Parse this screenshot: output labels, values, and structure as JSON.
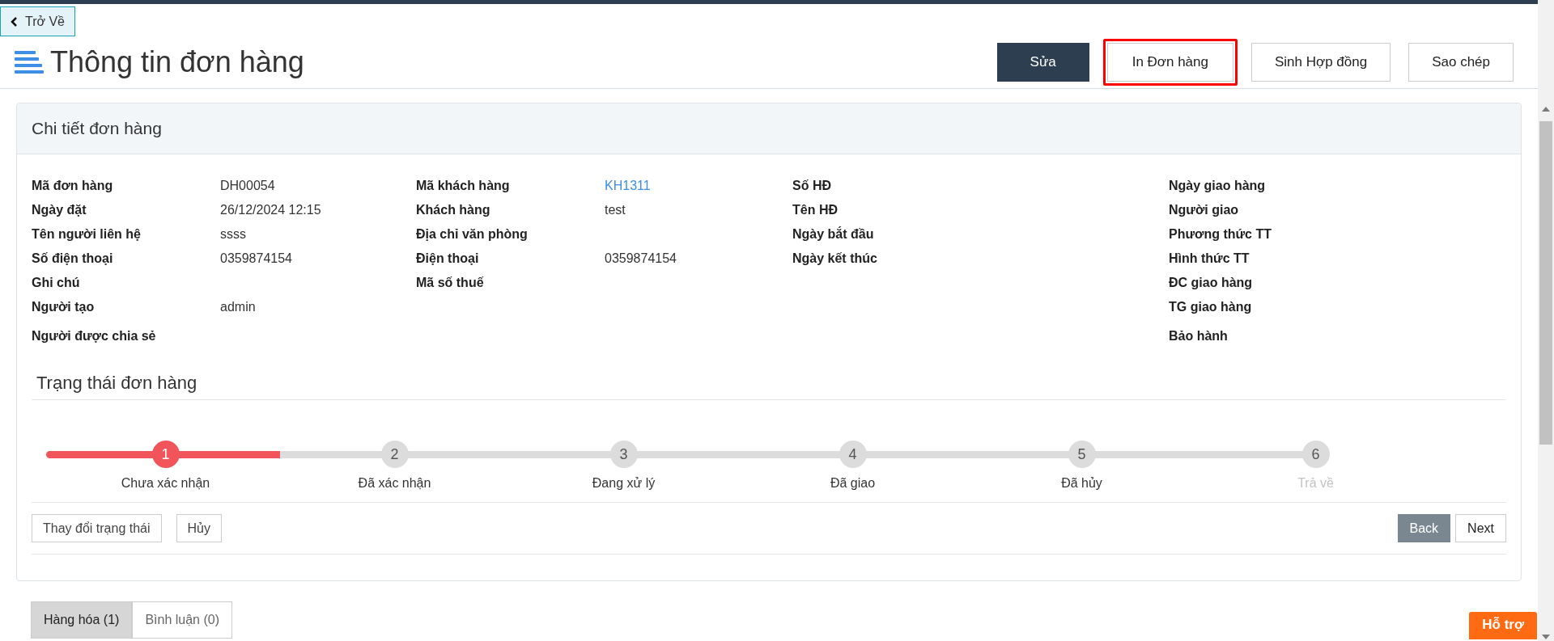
{
  "back_button": {
    "label": "Trở Về"
  },
  "header": {
    "title": "Thông tin đơn hàng"
  },
  "actions": [
    {
      "label": "Sửa",
      "kind": "primary",
      "highlighted": false
    },
    {
      "label": "In Đơn hàng",
      "kind": "default",
      "highlighted": true
    },
    {
      "label": "Sinh Hợp đồng",
      "kind": "default",
      "highlighted": false
    },
    {
      "label": "Sao chép",
      "kind": "default",
      "highlighted": false
    }
  ],
  "card": {
    "title": "Chi tiết đơn hàng",
    "field_columns": [
      [
        {
          "label": "Mã đơn hàng",
          "value": "DH00054"
        },
        {
          "label": "Ngày đặt",
          "value": "26/12/2024 12:15"
        },
        {
          "label": "Tên người liên hệ",
          "value": "ssss"
        },
        {
          "label": "Số điện thoại",
          "value": "0359874154"
        },
        {
          "label": "Ghi chú"
        },
        {
          "label": "Người tạo",
          "value": "admin"
        },
        {
          "label": "Người được chia sẻ"
        }
      ],
      [
        {
          "label": "Mã khách hàng",
          "value": "KH1311",
          "kind": "link"
        },
        {
          "label": "Khách hàng",
          "value": "test"
        },
        {
          "label": "Địa chỉ văn phòng"
        },
        {
          "label": "Điện thoại",
          "value": "0359874154"
        },
        {
          "label": "Mã số thuế"
        }
      ],
      [
        {
          "label": "Số HĐ"
        },
        {
          "label": "Tên HĐ"
        },
        {
          "label": "Ngày bắt đầu"
        },
        {
          "label": "Ngày kết thúc"
        }
      ],
      [
        {
          "label": "Ngày giao hàng"
        },
        {
          "label": "Người giao"
        },
        {
          "label": "Phương thức TT"
        },
        {
          "label": "Hình thức TT"
        },
        {
          "label": "ĐC giao hàng"
        },
        {
          "label": "TG giao hàng"
        },
        {
          "label": "Bảo hành"
        }
      ]
    ],
    "status": {
      "title": "Trạng thái đơn hàng",
      "steps": [
        {
          "number": "1",
          "label": "Chưa xác nhận",
          "selected": true,
          "disabled": false
        },
        {
          "number": "2",
          "label": "Đã xác nhận",
          "selected": false,
          "disabled": false
        },
        {
          "number": "3",
          "label": "Đang xử lý",
          "selected": false,
          "disabled": false
        },
        {
          "number": "4",
          "label": "Đã giao",
          "selected": false,
          "disabled": false
        },
        {
          "number": "5",
          "label": "Đã hủy",
          "selected": false,
          "disabled": false
        },
        {
          "number": "6",
          "label": "Trả về",
          "selected": false,
          "disabled": true
        }
      ],
      "left_buttons": [
        "Thay đổi trạng thái",
        "Hủy"
      ],
      "nav_buttons": [
        {
          "label": "Back",
          "kind": "dark"
        },
        {
          "label": "Next",
          "kind": "light"
        }
      ]
    }
  },
  "tabs": [
    {
      "label": "Hàng hóa (1)",
      "selected": true
    },
    {
      "label": "Bình luận (0)",
      "selected": false
    }
  ],
  "support_button": {
    "label": "Hỗ trợ"
  }
}
